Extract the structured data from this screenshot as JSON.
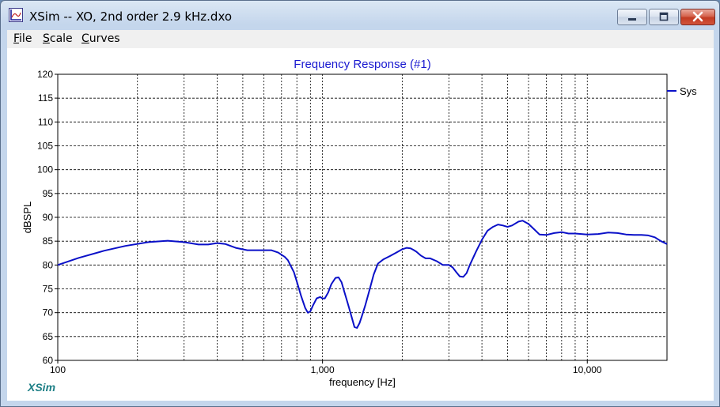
{
  "window": {
    "title": "XSim -- XO, 2nd order 2.9 kHz.dxo",
    "controls": [
      "minimize",
      "maximize",
      "close"
    ],
    "app_icon": "xsim-app-icon"
  },
  "menu": {
    "items": [
      "File",
      "Scale",
      "Curves"
    ],
    "mnemonics": [
      "F",
      "S",
      "C"
    ]
  },
  "watermark": "XSim",
  "colors": {
    "curve": "#0a10c8",
    "title": "#1a1ad0",
    "watermark": "#1d7f86",
    "close_button": "#c23b22"
  },
  "chart_data": {
    "type": "line",
    "title": "Frequency Response (#1)",
    "xlabel": "frequency [Hz]",
    "ylabel": "dBSPL",
    "xscale": "log",
    "xlim": [
      100,
      20000
    ],
    "ylim": [
      60,
      120
    ],
    "x_ticks": [
      100,
      1000,
      10000
    ],
    "x_tick_labels": [
      "100",
      "1,000",
      "10,000"
    ],
    "y_ticks": [
      60,
      65,
      70,
      75,
      80,
      85,
      90,
      95,
      100,
      105,
      110,
      115,
      120
    ],
    "grid": true,
    "legend_position": "right",
    "series": [
      {
        "name": "Sys",
        "color": "#0a10c8",
        "x": [
          100,
          120,
          150,
          180,
          220,
          260,
          300,
          340,
          370,
          400,
          430,
          470,
          520,
          600,
          640,
          680,
          720,
          740,
          780,
          800,
          830,
          860,
          880,
          900,
          920,
          950,
          980,
          1000,
          1020,
          1050,
          1080,
          1120,
          1150,
          1180,
          1200,
          1230,
          1260,
          1290,
          1320,
          1350,
          1380,
          1410,
          1450,
          1500,
          1560,
          1620,
          1700,
          1800,
          1900,
          2000,
          2080,
          2150,
          2200,
          2260,
          2350,
          2450,
          2550,
          2700,
          2850,
          3000,
          3100,
          3200,
          3300,
          3400,
          3500,
          3600,
          3800,
          4000,
          4200,
          4400,
          4600,
          4800,
          5000,
          5200,
          5500,
          5700,
          6000,
          6300,
          6600,
          7000,
          7500,
          8000,
          8500,
          9000,
          9500,
          10000,
          11000,
          12000,
          13000,
          14000,
          15000,
          16000,
          17000,
          18000,
          19000,
          20000
        ],
        "y": [
          80,
          81.5,
          83,
          84,
          84.8,
          85.1,
          84.8,
          84.3,
          84.3,
          84.6,
          84.4,
          83.6,
          83.1,
          83.1,
          83.1,
          82.6,
          81.7,
          81,
          78.5,
          76.5,
          73.5,
          71,
          70,
          70.3,
          71.5,
          73,
          73.3,
          73.0,
          73,
          74.2,
          76,
          77.3,
          77.4,
          76.4,
          75,
          73,
          71,
          69,
          67,
          66.8,
          67.8,
          69.4,
          71.5,
          74.5,
          78,
          80.3,
          81.2,
          81.9,
          82.6,
          83.3,
          83.6,
          83.5,
          83.2,
          82.8,
          82,
          81.4,
          81.4,
          80.8,
          80,
          80,
          79.5,
          78.5,
          77.6,
          77.5,
          78.3,
          80,
          82.8,
          85.3,
          87.2,
          88,
          88.5,
          88.3,
          88,
          88.3,
          89.1,
          89.3,
          88.6,
          87.5,
          86.4,
          86.3,
          86.7,
          86.9,
          86.6,
          86.6,
          86.5,
          86.4,
          86.5,
          86.8,
          86.7,
          86.4,
          86.3,
          86.3,
          86.2,
          85.8,
          85,
          84.4
        ]
      }
    ]
  }
}
